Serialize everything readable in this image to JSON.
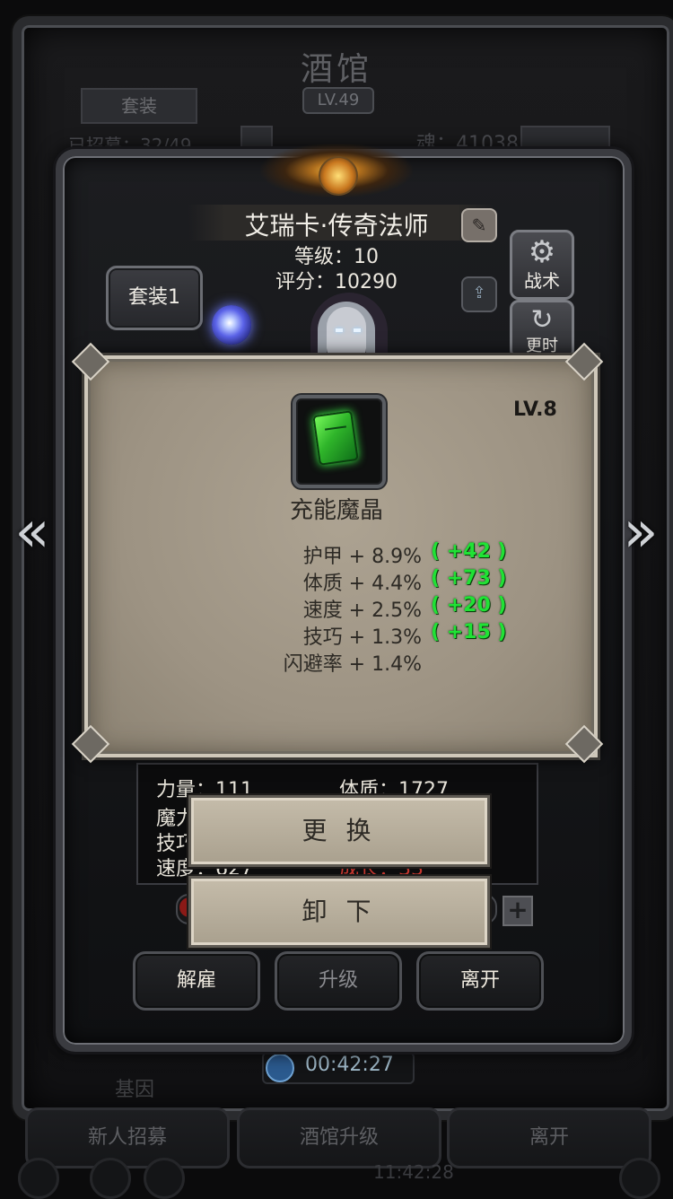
{
  "background": {
    "title": "酒馆",
    "level": "LV.49",
    "tab_outfit": "套装",
    "recruit_count": "已招募：32/49",
    "soul": "魂：41038",
    "timer": "00:42:27",
    "team_label": "基因",
    "buttons": [
      "新人招募",
      "酒馆升级",
      "离开"
    ],
    "clock": "11:42:28"
  },
  "hero": {
    "name": "艾瑞卡·传奇法师",
    "level": "等级：10",
    "score": "评分：10290",
    "outfit_label": "套装1",
    "tactic_label": "战术",
    "swap_label": "更时",
    "stats": {
      "strength": "力量：111",
      "constitution": "体质：1727",
      "magic": "魔力",
      "skill": "技巧",
      "speed": "速度：627",
      "growth": "成长：33"
    },
    "buttons": {
      "dismiss": "解雇",
      "upgrade": "升级",
      "leave": "离开"
    }
  },
  "item": {
    "level": "LV.8",
    "name": "充能魔晶",
    "attributes": [
      {
        "label": "护甲 + 8.9%",
        "bonus": "( +42 )"
      },
      {
        "label": "体质 + 4.4%",
        "bonus": "( +73 )"
      },
      {
        "label": "速度 + 2.5%",
        "bonus": "( +20 )"
      },
      {
        "label": "技巧 + 1.3%",
        "bonus": "( +15 )"
      },
      {
        "label": "闪避率 + 1.4%",
        "bonus": ""
      }
    ],
    "actions": {
      "replace": "更 换",
      "unequip": "卸 下"
    }
  },
  "nav": {
    "prev": "«",
    "next": "»"
  },
  "colors": {
    "bonus_green": "#20e235",
    "growth_red": "#c3362e",
    "popup_parchment": "#a39988"
  }
}
